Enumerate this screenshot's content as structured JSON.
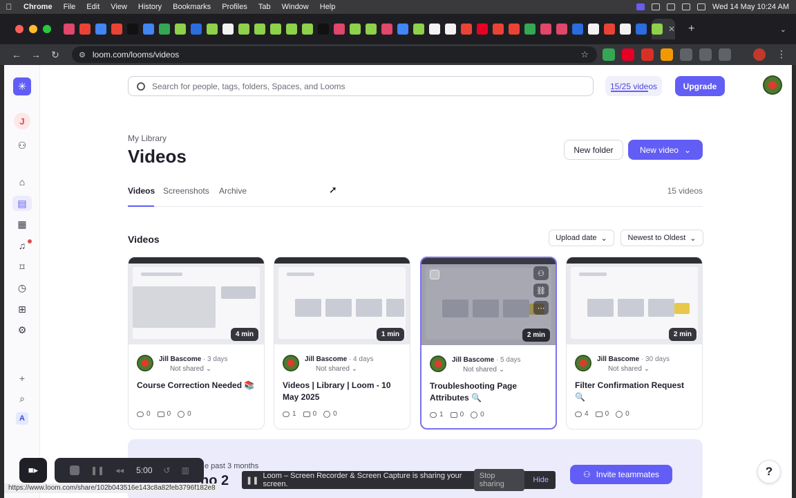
{
  "os_menu": {
    "app": "Chrome",
    "items": [
      "File",
      "Edit",
      "View",
      "History",
      "Bookmarks",
      "Profiles",
      "Tab",
      "Window",
      "Help"
    ],
    "clock": "Wed 14 May  10:24 AM"
  },
  "browser": {
    "url": "loom.com/looms/videos",
    "status_url": "https://www.loom.com/share/102b043516e143c8a82feb3796f182e8"
  },
  "header": {
    "search_placeholder": "Search for people, tags, folders, Spaces, and Looms",
    "quota": "15/25 videos",
    "upgrade": "Upgrade"
  },
  "sidebar": {
    "workspace_initial": "J",
    "account_badge": "A"
  },
  "library": {
    "breadcrumb": "My Library",
    "title": "Videos",
    "new_folder": "New folder",
    "new_video": "New video",
    "tabs": [
      "Videos",
      "Screenshots",
      "Archive"
    ],
    "count": "15 videos",
    "section_title": "Videos",
    "sort_field": "Upload date",
    "sort_order": "Newest to Oldest"
  },
  "videos": [
    {
      "duration": "4 min",
      "author": "Jill Bascome",
      "ago": "· 3 days",
      "shared": "Not shared",
      "title": "Course Correction Needed 📚",
      "views": "0",
      "comments": "0",
      "reactions": "0"
    },
    {
      "duration": "1 min",
      "author": "Jill Bascome",
      "ago": "· 4 days",
      "shared": "Not shared",
      "title": "Videos | Library | Loom - 10 May 2025",
      "views": "1",
      "comments": "0",
      "reactions": "0"
    },
    {
      "duration": "2 min",
      "author": "Jill Bascome",
      "ago": "· 5 days",
      "shared": "Not shared",
      "title": "Troubleshooting Page Attributes 🔍",
      "views": "1",
      "comments": "0",
      "reactions": "0"
    },
    {
      "duration": "2 min",
      "author": "Jill Bascome",
      "ago": "· 30 days",
      "shared": "Not shared",
      "title": "Filter Confirmation Request 🔍",
      "views": "4",
      "comments": "0",
      "reactions": "0"
    }
  ],
  "promo": {
    "text": "e past 3 months",
    "big": "no 2",
    "invite": "Invite teammates"
  },
  "recorder": {
    "timer": "5:00",
    "share_message": "Loom – Screen Recorder & Screen Capture is sharing your screen.",
    "stop_sharing": "Stop sharing",
    "hide": "Hide"
  },
  "colors": {
    "accent": "#625df5",
    "accent_soft": "#ecebfb",
    "card_hover_border": "#7a72ef"
  }
}
